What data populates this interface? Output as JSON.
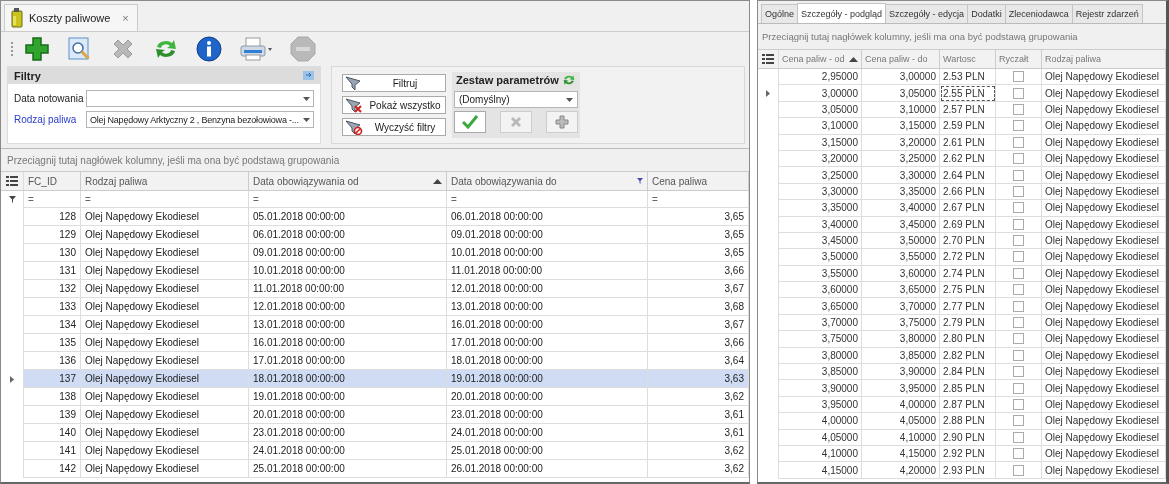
{
  "fuel_costs_window": {
    "tab": {
      "label": "Koszty paliwowe",
      "close": "×"
    },
    "toolbar": [
      {
        "kind": "add",
        "disabled": false
      },
      {
        "kind": "preview",
        "disabled": false
      },
      {
        "kind": "delete",
        "disabled": true
      },
      {
        "kind": "refresh",
        "disabled": false
      },
      {
        "kind": "info",
        "disabled": false
      },
      {
        "kind": "print",
        "disabled": false
      },
      {
        "kind": "stop",
        "disabled": true
      }
    ],
    "filters": {
      "title": "Filtry",
      "fields": [
        {
          "label": "Data notowania",
          "highlighted": false
        },
        {
          "label": "Rodzaj paliwa",
          "value": "Olej Napędowy Arktyczny 2 , Benzyna bezołowiowa -...",
          "highlighted": true
        }
      ]
    },
    "filter_buttons": [
      {
        "kind": "filter",
        "label": "Filtruj"
      },
      {
        "kind": "show-all",
        "label": "Pokaż wszystko"
      },
      {
        "kind": "clear",
        "label": "Wyczyść filtry"
      }
    ],
    "parameter_set": {
      "title": "Zestaw parametrów",
      "value": "(Domyślny)",
      "actions": [
        {
          "kind": "accept",
          "disabled": false
        },
        {
          "kind": "delete",
          "disabled": true
        },
        {
          "kind": "add",
          "disabled": true
        }
      ]
    },
    "grid": {
      "group_hint": "Przeciągnij tutaj nagłówek kolumny, jeśli ma ona być podstawą grupowania",
      "columns": [
        {
          "label": "FC_ID",
          "sorted": false,
          "filtered": false
        },
        {
          "label": "Rodzaj paliwa",
          "sorted": false,
          "filtered": false
        },
        {
          "label": "Data obowiązywania od",
          "sorted": true,
          "filtered": false
        },
        {
          "label": "Data obowiązywania do",
          "sorted": false,
          "filtered": true
        },
        {
          "label": "Cena paliwa",
          "sorted": false,
          "filtered": false
        }
      ],
      "filter_row": [
        "=",
        "=",
        "=",
        "=",
        "="
      ],
      "rows": [
        {
          "cells": [
            "128",
            "Olej Napędowy Ekodiesel",
            "05.01.2018 00:00:00",
            "06.01.2018 00:00:00",
            "3,65"
          ],
          "selected": false
        },
        {
          "cells": [
            "129",
            "Olej Napędowy Ekodiesel",
            "06.01.2018 00:00:00",
            "09.01.2018 00:00:00",
            "3,65"
          ],
          "selected": false
        },
        {
          "cells": [
            "130",
            "Olej Napędowy Ekodiesel",
            "09.01.2018 00:00:00",
            "10.01.2018 00:00:00",
            "3,65"
          ],
          "selected": false
        },
        {
          "cells": [
            "131",
            "Olej Napędowy Ekodiesel",
            "10.01.2018 00:00:00",
            "11.01.2018 00:00:00",
            "3,66"
          ],
          "selected": false
        },
        {
          "cells": [
            "132",
            "Olej Napędowy Ekodiesel",
            "11.01.2018 00:00:00",
            "12.01.2018 00:00:00",
            "3,67"
          ],
          "selected": false
        },
        {
          "cells": [
            "133",
            "Olej Napędowy Ekodiesel",
            "12.01.2018 00:00:00",
            "13.01.2018 00:00:00",
            "3,68"
          ],
          "selected": false
        },
        {
          "cells": [
            "134",
            "Olej Napędowy Ekodiesel",
            "13.01.2018 00:00:00",
            "16.01.2018 00:00:00",
            "3,67"
          ],
          "selected": false
        },
        {
          "cells": [
            "135",
            "Olej Napędowy Ekodiesel",
            "16.01.2018 00:00:00",
            "17.01.2018 00:00:00",
            "3,66"
          ],
          "selected": false
        },
        {
          "cells": [
            "136",
            "Olej Napędowy Ekodiesel",
            "17.01.2018 00:00:00",
            "18.01.2018 00:00:00",
            "3,64"
          ],
          "selected": false
        },
        {
          "cells": [
            "137",
            "Olej Napędowy Ekodiesel",
            "18.01.2018 00:00:00",
            "19.01.2018 00:00:00",
            "3,63"
          ],
          "selected": true
        },
        {
          "cells": [
            "138",
            "Olej Napędowy Ekodiesel",
            "19.01.2018 00:00:00",
            "20.01.2018 00:00:00",
            "3,62"
          ],
          "selected": false
        },
        {
          "cells": [
            "139",
            "Olej Napędowy Ekodiesel",
            "20.01.2018 00:00:00",
            "23.01.2018 00:00:00",
            "3,61"
          ],
          "selected": false
        },
        {
          "cells": [
            "140",
            "Olej Napędowy Ekodiesel",
            "23.01.2018 00:00:00",
            "24.01.2018 00:00:00",
            "3,61"
          ],
          "selected": false
        },
        {
          "cells": [
            "141",
            "Olej Napędowy Ekodiesel",
            "24.01.2018 00:00:00",
            "25.01.2018 00:00:00",
            "3,62"
          ],
          "selected": false
        },
        {
          "cells": [
            "142",
            "Olej Napędowy Ekodiesel",
            "25.01.2018 00:00:00",
            "26.01.2018 00:00:00",
            "3,62"
          ],
          "selected": false
        }
      ]
    }
  },
  "details_window": {
    "tabs": [
      {
        "label": "Ogólne",
        "selected": false
      },
      {
        "label": "Szczegóły - podgląd",
        "selected": true
      },
      {
        "label": "Szczegóły - edycja",
        "selected": false
      },
      {
        "label": "Dodatki",
        "selected": false
      },
      {
        "label": "Zleceniodawca",
        "selected": false
      },
      {
        "label": "Rejestr zdarzeń",
        "selected": false
      }
    ],
    "group_hint": "Przeciągnij tutaj nagłówek kolumny, jeśli ma ona być podstawą grupowania",
    "columns": [
      {
        "label": "Cena paliw - od",
        "sorted": true
      },
      {
        "label": "Cena paliw - do",
        "sorted": false
      },
      {
        "label": "Wartosc",
        "sorted": false
      },
      {
        "label": "Ryczałt",
        "sorted": false
      },
      {
        "label": "Rodzaj paliwa",
        "sorted": false
      }
    ],
    "rows": [
      {
        "from": "2,95000",
        "to": "3,00000",
        "value": "2.53 PLN",
        "flat_rate": false,
        "fuel": "Olej Napędowy Ekodiesel",
        "current": false
      },
      {
        "from": "3,00000",
        "to": "3,05000",
        "value": "2.55 PLN",
        "flat_rate": false,
        "fuel": "Olej Napędowy Ekodiesel",
        "current": true
      },
      {
        "from": "3,05000",
        "to": "3,10000",
        "value": "2.57 PLN",
        "flat_rate": false,
        "fuel": "Olej Napędowy Ekodiesel",
        "current": false
      },
      {
        "from": "3,10000",
        "to": "3,15000",
        "value": "2.59 PLN",
        "flat_rate": false,
        "fuel": "Olej Napędowy Ekodiesel",
        "current": false
      },
      {
        "from": "3,15000",
        "to": "3,20000",
        "value": "2.61 PLN",
        "flat_rate": false,
        "fuel": "Olej Napędowy Ekodiesel",
        "current": false
      },
      {
        "from": "3,20000",
        "to": "3,25000",
        "value": "2.62 PLN",
        "flat_rate": false,
        "fuel": "Olej Napędowy Ekodiesel",
        "current": false
      },
      {
        "from": "3,25000",
        "to": "3,30000",
        "value": "2.64 PLN",
        "flat_rate": false,
        "fuel": "Olej Napędowy Ekodiesel",
        "current": false
      },
      {
        "from": "3,30000",
        "to": "3,35000",
        "value": "2.66 PLN",
        "flat_rate": false,
        "fuel": "Olej Napędowy Ekodiesel",
        "current": false
      },
      {
        "from": "3,35000",
        "to": "3,40000",
        "value": "2.67 PLN",
        "flat_rate": false,
        "fuel": "Olej Napędowy Ekodiesel",
        "current": false
      },
      {
        "from": "3,40000",
        "to": "3,45000",
        "value": "2.69 PLN",
        "flat_rate": false,
        "fuel": "Olej Napędowy Ekodiesel",
        "current": false
      },
      {
        "from": "3,45000",
        "to": "3,50000",
        "value": "2.70 PLN",
        "flat_rate": false,
        "fuel": "Olej Napędowy Ekodiesel",
        "current": false
      },
      {
        "from": "3,50000",
        "to": "3,55000",
        "value": "2.72 PLN",
        "flat_rate": false,
        "fuel": "Olej Napędowy Ekodiesel",
        "current": false
      },
      {
        "from": "3,55000",
        "to": "3,60000",
        "value": "2.74 PLN",
        "flat_rate": false,
        "fuel": "Olej Napędowy Ekodiesel",
        "current": false
      },
      {
        "from": "3,60000",
        "to": "3,65000",
        "value": "2.75 PLN",
        "flat_rate": false,
        "fuel": "Olej Napędowy Ekodiesel",
        "current": false
      },
      {
        "from": "3,65000",
        "to": "3,70000",
        "value": "2.77 PLN",
        "flat_rate": false,
        "fuel": "Olej Napędowy Ekodiesel",
        "current": false
      },
      {
        "from": "3,70000",
        "to": "3,75000",
        "value": "2.79 PLN",
        "flat_rate": false,
        "fuel": "Olej Napędowy Ekodiesel",
        "current": false
      },
      {
        "from": "3,75000",
        "to": "3,80000",
        "value": "2.80 PLN",
        "flat_rate": false,
        "fuel": "Olej Napędowy Ekodiesel",
        "current": false
      },
      {
        "from": "3,80000",
        "to": "3,85000",
        "value": "2.82 PLN",
        "flat_rate": false,
        "fuel": "Olej Napędowy Ekodiesel",
        "current": false
      },
      {
        "from": "3,85000",
        "to": "3,90000",
        "value": "2.84 PLN",
        "flat_rate": false,
        "fuel": "Olej Napędowy Ekodiesel",
        "current": false
      },
      {
        "from": "3,90000",
        "to": "3,95000",
        "value": "2.85 PLN",
        "flat_rate": false,
        "fuel": "Olej Napędowy Ekodiesel",
        "current": false
      },
      {
        "from": "3,95000",
        "to": "4,00000",
        "value": "2.87 PLN",
        "flat_rate": false,
        "fuel": "Olej Napędowy Ekodiesel",
        "current": false
      },
      {
        "from": "4,00000",
        "to": "4,05000",
        "value": "2.88 PLN",
        "flat_rate": false,
        "fuel": "Olej Napędowy Ekodiesel",
        "current": false
      },
      {
        "from": "4,05000",
        "to": "4,10000",
        "value": "2.90 PLN",
        "flat_rate": false,
        "fuel": "Olej Napędowy Ekodiesel",
        "current": false
      },
      {
        "from": "4,10000",
        "to": "4,15000",
        "value": "2.92 PLN",
        "flat_rate": false,
        "fuel": "Olej Napędowy Ekodiesel",
        "current": false
      },
      {
        "from": "4,15000",
        "to": "4,20000",
        "value": "2.93 PLN",
        "flat_rate": false,
        "fuel": "Olej Napędowy Ekodiesel",
        "current": false
      }
    ]
  }
}
